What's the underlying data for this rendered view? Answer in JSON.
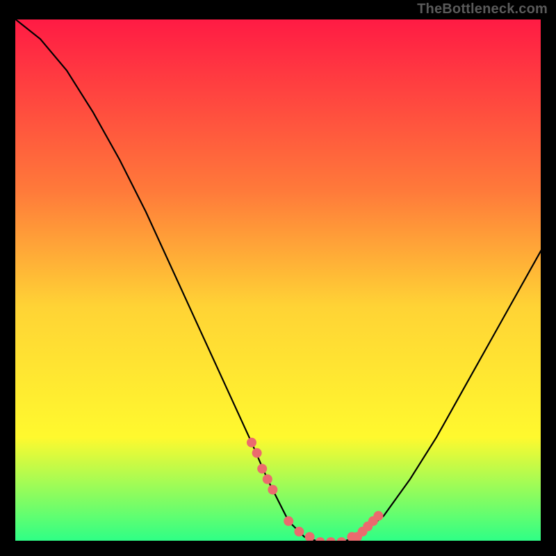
{
  "watermark": "TheBottleneck.com",
  "colors": {
    "frame_border": "#000000",
    "curve": "#000000",
    "marker_fill": "#eb6a6e",
    "gradient_top": "#ff1a44",
    "gradient_mid_upper": "#ff7a3a",
    "gradient_mid": "#ffd335",
    "gradient_mid_lower": "#fff92e",
    "gradient_bottom": "#2cff87"
  },
  "chart_data": {
    "type": "line",
    "title": "",
    "xlabel": "",
    "ylabel": "",
    "xlim": [
      0,
      100
    ],
    "ylim": [
      0,
      100
    ],
    "grid": false,
    "legend": false,
    "x": [
      0,
      5,
      10,
      15,
      20,
      25,
      30,
      35,
      40,
      45,
      48,
      50,
      52,
      55,
      58,
      60,
      62,
      65,
      70,
      75,
      80,
      85,
      90,
      95,
      100
    ],
    "values": [
      100,
      96,
      90,
      82,
      73,
      63,
      52,
      41,
      30,
      19,
      12,
      8,
      4,
      1,
      0,
      0,
      0,
      1,
      5,
      12,
      20,
      29,
      38,
      47,
      56
    ],
    "markers": {
      "x": [
        45,
        46,
        47,
        48,
        49,
        52,
        54,
        56,
        58,
        60,
        62,
        64,
        65,
        66,
        67,
        68,
        69
      ],
      "y": [
        19,
        17,
        14,
        12,
        10,
        4,
        2,
        1,
        0,
        0,
        0,
        1,
        1,
        2,
        3,
        4,
        5
      ]
    }
  }
}
